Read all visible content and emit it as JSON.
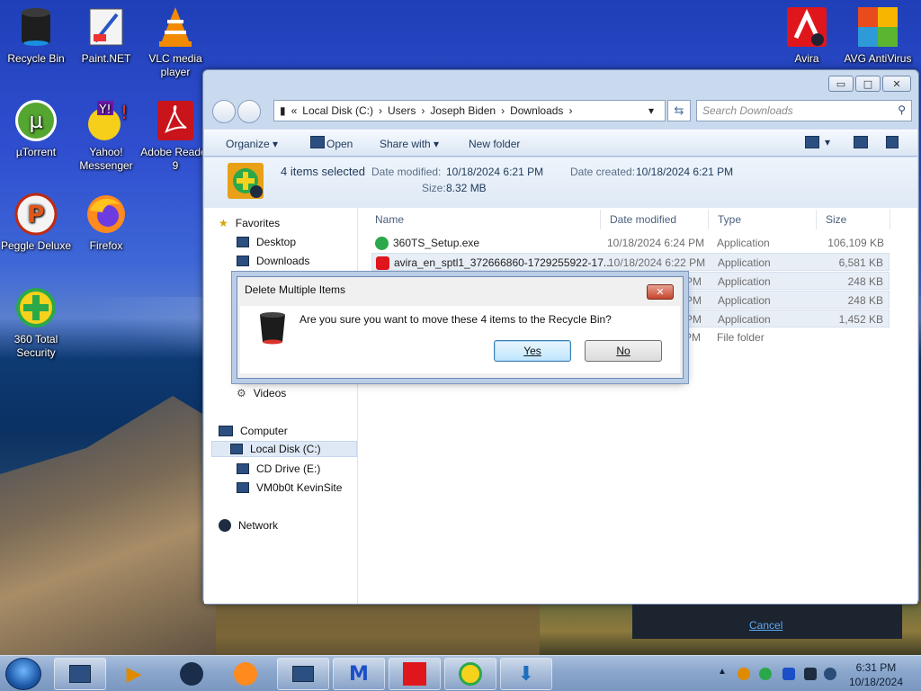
{
  "desktop_icons": [
    {
      "label": "Recycle Bin"
    },
    {
      "label": "Paint.NET"
    },
    {
      "label": "VLC media player"
    },
    {
      "label": "µTorrent"
    },
    {
      "label": "Yahoo! Messenger"
    },
    {
      "label": "Adobe Reader 9"
    },
    {
      "label": "Peggle Deluxe"
    },
    {
      "label": "Firefox"
    },
    {
      "label": "360 Total Security"
    },
    {
      "label": "Avira"
    },
    {
      "label": "AVG AntiVirus"
    }
  ],
  "explorer": {
    "address": [
      "«",
      "Local Disk (C:)",
      "›",
      "Users",
      "›",
      "Joseph Biden",
      "›",
      "Downloads",
      "›"
    ],
    "search_placeholder": "Search Downloads",
    "toolbar": {
      "organize": "Organize ▾",
      "open": "Open",
      "share_with": "Share with ▾",
      "new_folder": "New folder"
    },
    "details": {
      "summary": "4 items selected",
      "date_modified_label": "Date modified:",
      "date_modified": "10/18/2024 6:21 PM",
      "date_created_label": "Date created:",
      "date_created": "10/18/2024 6:21 PM",
      "size_label": "Size:",
      "size": "8.32 MB"
    },
    "nav": {
      "favorites": "Favorites",
      "desktop": "Desktop",
      "downloads": "Downloads",
      "videos": "Videos",
      "computer": "Computer",
      "local_disk": "Local Disk (C:)",
      "cd_drive": "CD Drive (E:)",
      "vm": "VM0b0t KevinSite",
      "network": "Network"
    },
    "columns": {
      "name": "Name",
      "date": "Date modified",
      "type": "Type",
      "size": "Size"
    },
    "files": [
      {
        "name": "360TS_Setup.exe",
        "date": "10/18/2024 6:24 PM",
        "type": "Application",
        "size": "106,109 KB"
      },
      {
        "name": "avira_en_sptl1_372666860-1729255922-17...",
        "date": "10/18/2024 6:22 PM",
        "type": "Application",
        "size": "6,581 KB"
      },
      {
        "name": "",
        "date": "PM",
        "type": "Application",
        "size": "248 KB"
      },
      {
        "name": "",
        "date": "PM",
        "type": "Application",
        "size": "248 KB"
      },
      {
        "name": "",
        "date": "PM",
        "type": "Application",
        "size": "1,452 KB"
      },
      {
        "name": "",
        "date": "PM",
        "type": "File folder",
        "size": ""
      }
    ]
  },
  "dialog": {
    "title": "Delete Multiple Items",
    "message": "Are you sure you want to move these 4 items to the Recycle Bin?",
    "yes": "Yes",
    "no": "No"
  },
  "progress": {
    "cancel": "Cancel"
  },
  "taskbar": {
    "time": "6:31 PM",
    "date": "10/18/2024"
  },
  "colors": {
    "selection": "#e8eef6",
    "dialog_default": "#3c7fb1",
    "link": "#5fa8f0"
  }
}
